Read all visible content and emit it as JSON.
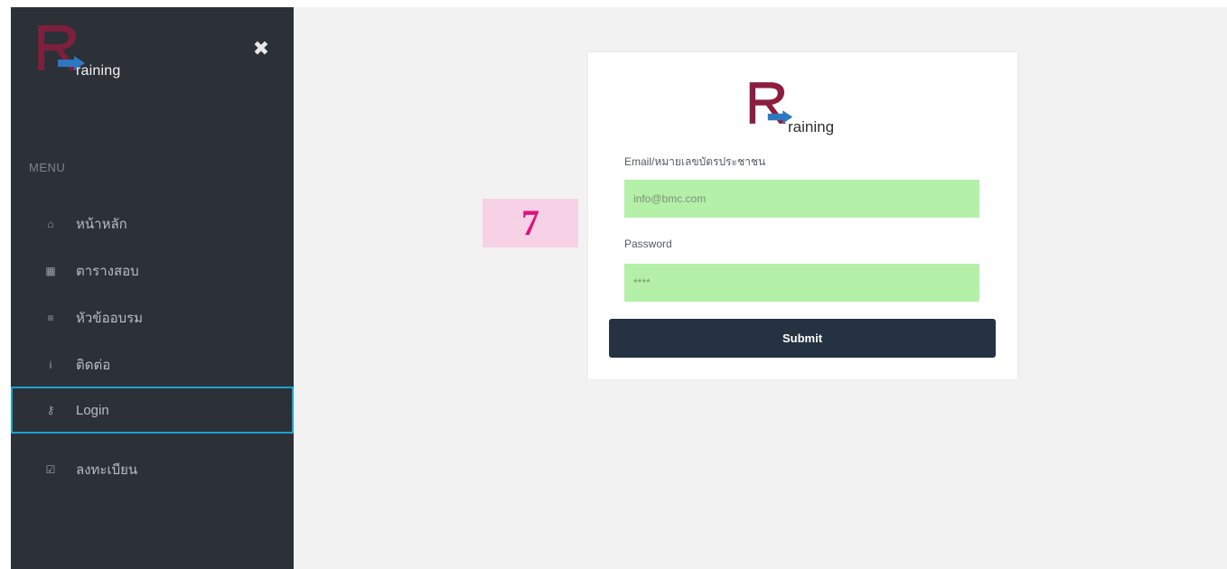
{
  "brand": {
    "logo_letter": "R",
    "logo_text": "raining",
    "accent_color": "#8b1e3f",
    "arrow_color": "#2e78c2"
  },
  "sidebar": {
    "menu_heading": "MENU",
    "close_icon": "close-icon",
    "items": [
      {
        "label": "หน้าหลัก",
        "icon": "home-icon"
      },
      {
        "label": "ตารางสอบ",
        "icon": "calendar-icon"
      },
      {
        "label": "หัวข้ออบรม",
        "icon": "list-icon"
      },
      {
        "label": "ติดต่อ",
        "icon": "info-icon"
      },
      {
        "label": "Login",
        "icon": "key-icon",
        "active": true
      },
      {
        "label": "ลงทะเบียน",
        "icon": "checkbox-icon"
      }
    ]
  },
  "annotation": {
    "text": "7"
  },
  "login_form": {
    "email_label": "Email/หมายเลขบัตรประชาชน",
    "email_value": "info@bmc.com",
    "password_label": "Password",
    "password_value": "****",
    "submit_label": "Submit",
    "input_bg": "#b4f0a8",
    "button_bg": "#243242"
  }
}
